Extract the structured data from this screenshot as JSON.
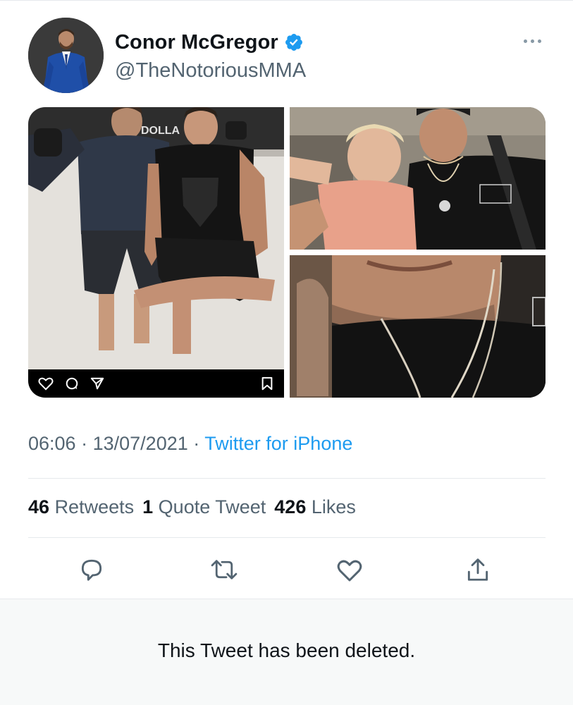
{
  "tweet": {
    "author": {
      "display_name": "Conor McGregor",
      "handle": "@TheNotoriousMMA",
      "verified": true,
      "verified_color": "#1d9bf0"
    },
    "more_icon": "more-dots-icon",
    "media": {
      "photo_count": 3,
      "overlay_icons": [
        "heart-icon",
        "comment-icon",
        "send-icon",
        "bookmark-icon"
      ],
      "overlay_text": "DOLLA"
    },
    "time": "06:06",
    "separator": "·",
    "date": "13/07/2021",
    "source": "Twitter for iPhone",
    "stats": {
      "retweets_count": "46",
      "retweets_label": "Retweets",
      "quotes_count": "1",
      "quotes_label": "Quote Tweet",
      "likes_count": "426",
      "likes_label": "Likes"
    },
    "actions": [
      "reply-icon",
      "retweet-icon",
      "like-icon",
      "share-icon"
    ],
    "deleted_notice": "This Tweet has been deleted.",
    "colors": {
      "text": "#0f1419",
      "secondary": "#536471",
      "link": "#1d9bf0",
      "divider": "#e6e9ec"
    }
  }
}
